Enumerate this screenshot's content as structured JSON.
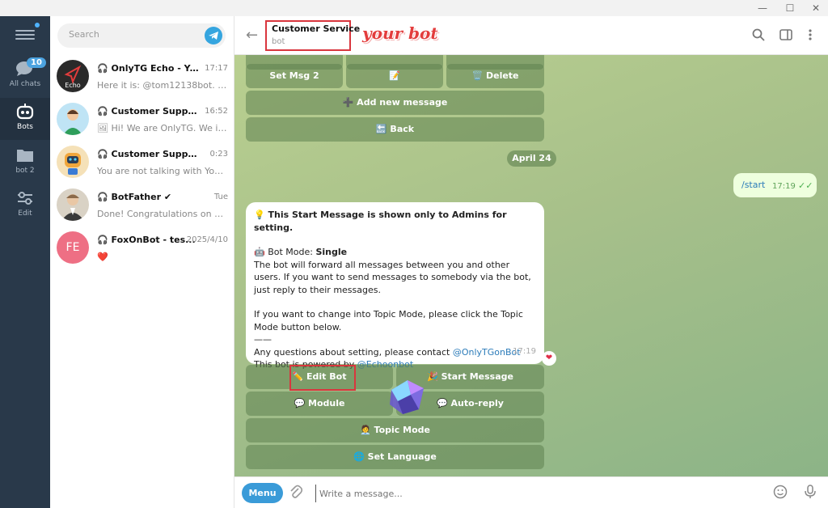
{
  "window": {
    "minimize": "—",
    "maximize": "☐",
    "close": "✕"
  },
  "rail": {
    "items": [
      {
        "label": "All chats",
        "badge": "10",
        "icon": "chat-bubbles-icon"
      },
      {
        "label": "Bots",
        "icon": "robot-icon",
        "active": true
      },
      {
        "label": "bot 2",
        "icon": "folder-icon"
      },
      {
        "label": "Edit",
        "icon": "sliders-icon"
      }
    ]
  },
  "search": {
    "placeholder": "Search"
  },
  "chats": [
    {
      "name": "🎧 OnlyTG Echo - Your ...",
      "time": "17:17",
      "preview": "Here it is: @tom12138bot. Wh...",
      "avatar_text": "Echo"
    },
    {
      "name": "🎧 Customer Support",
      "time": "16:52",
      "preview": "🖼 Hi! We are OnlyTG. We intr..."
    },
    {
      "name": "🎧 Customer Support",
      "time": "0:23",
      "preview": "You are not talking with Yousr..."
    },
    {
      "name": "🎧 BotFather ✔",
      "time": "Tue",
      "preview": "Done! Congratulations on you..."
    },
    {
      "name": "🎧 FoxOnBot - tes...",
      "time": "2025/4/10",
      "preview": "❤️",
      "avatar_text": "FE"
    }
  ],
  "header": {
    "title": "Customer Service",
    "subtitle": "bot",
    "annotation": "your bot"
  },
  "keyboard_top": {
    "row1": [
      "Set Msg 2",
      "📝",
      "🗑️ Delete"
    ],
    "add": "➕ Add new message",
    "back": "🔙 Back"
  },
  "date_label": "April 24",
  "outgoing": {
    "text": "/start",
    "time": "17:19"
  },
  "message": {
    "line1": "💡 This Start Message is shown only to Admins for setting.",
    "mode_prefix": "🤖 Bot Mode: ",
    "mode_value": "Single",
    "para1": "The bot will forward all messages between you and other users. If you want to send messages to somebody via the bot, just reply to their messages.",
    "para2": "If you want to change into Topic Mode, please click the Topic Mode button below.",
    "divider": "——",
    "contact_prefix": "Any questions about setting, please contact ",
    "contact_link": "@OnlyTGonBot",
    "powered_prefix": "This bot is powered by ",
    "powered_link": "@Echoonbot",
    "time": "17:19",
    "reaction": "❤"
  },
  "keyboard_bottom": {
    "edit_bot": "✏️ Edit Bot",
    "start_message": "🎉 Start Message",
    "module": "💬 Module",
    "auto_reply": "💬 Auto-reply",
    "topic_mode": "🧑‍💼 Topic Mode",
    "set_language": "🌐 Set Language"
  },
  "composer": {
    "menu_label": "Menu",
    "placeholder": "Write a message..."
  }
}
